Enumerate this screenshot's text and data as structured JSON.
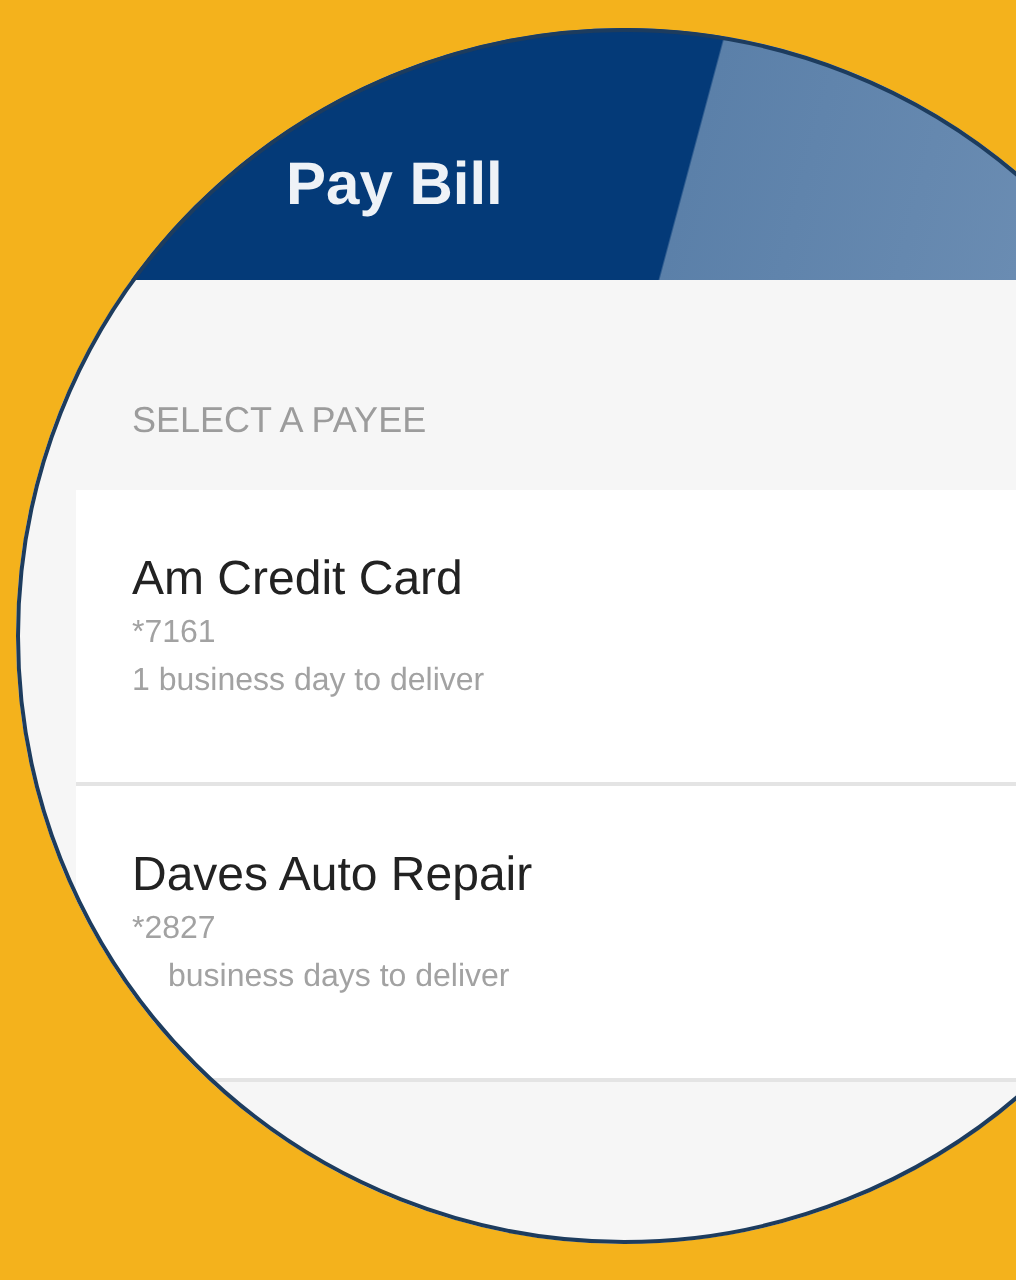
{
  "header": {
    "title": "Pay Bill"
  },
  "section_label": "SELECT A PAYEE",
  "payees": [
    {
      "name": "Am Credit Card",
      "account": "*7161",
      "delivery": "1 business day to deliver"
    },
    {
      "name": "Daves Auto Repair",
      "account": "*2827",
      "delivery": "business days to deliver"
    }
  ]
}
